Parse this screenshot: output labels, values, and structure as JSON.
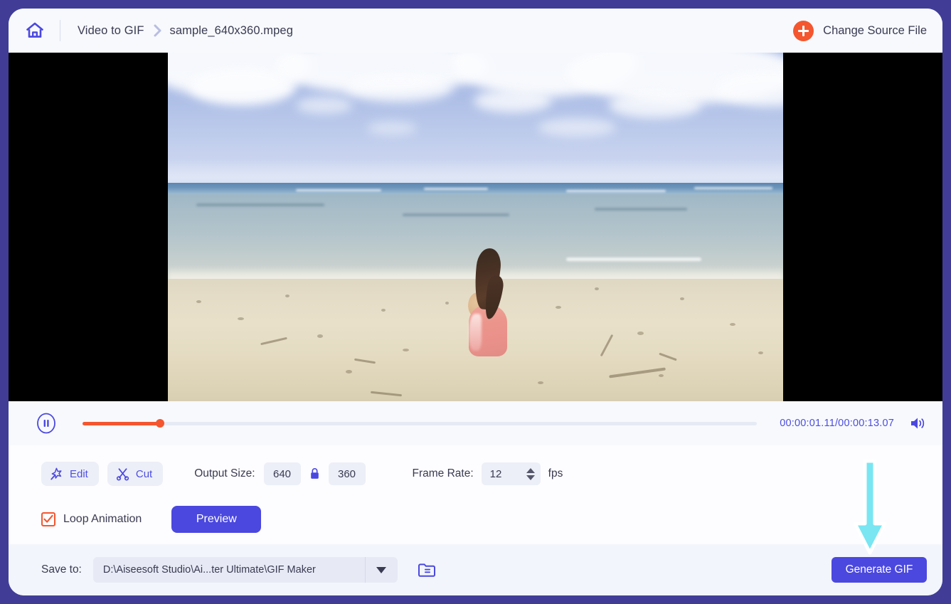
{
  "window": {
    "frame_color": "#413d97",
    "accent_indigo": "#4b48df",
    "accent_orange": "#f4562f",
    "arrow_color": "#79e6f2"
  },
  "header": {
    "home_icon": "home-icon",
    "breadcrumb": {
      "section": "Video to GIF",
      "separator": "chevron-right-icon",
      "file": "sample_640x360.mpeg"
    },
    "change_source": {
      "icon": "plus-circle-icon",
      "label": "Change Source File"
    }
  },
  "video": {
    "scene_description": "girl sitting on beach facing ocean",
    "letterbox_color": "#000000"
  },
  "playback": {
    "play_pause_icon": "pause-icon",
    "progress_percent": 11.5,
    "current_time": "00:00:01.11",
    "separator": "/",
    "total_time": "00:00:13.07",
    "time_display": "00:00:01.11/00:00:13.07",
    "volume_icon": "volume-icon"
  },
  "settings": {
    "edit_button": {
      "icon": "magic-wand-icon",
      "label": "Edit"
    },
    "cut_button": {
      "icon": "scissors-icon",
      "label": "Cut"
    },
    "output_size": {
      "label": "Output Size:",
      "width": "640",
      "lock_icon": "lock-icon",
      "height": "360"
    },
    "frame_rate": {
      "label": "Frame Rate:",
      "value": "12",
      "spinner_icon": "spinner-updown-icon",
      "unit": "fps"
    },
    "loop_animation": {
      "label": "Loop Animation",
      "checked": true,
      "check_icon": "checkmark-icon"
    },
    "preview_button": "Preview"
  },
  "footer": {
    "save_label": "Save to:",
    "path_value": "D:\\Aiseesoft Studio\\Ai...ter Ultimate\\GIF Maker",
    "dropdown_icon": "chevron-down-icon",
    "folder_icon": "folder-open-icon",
    "generate_button": "Generate GIF"
  }
}
